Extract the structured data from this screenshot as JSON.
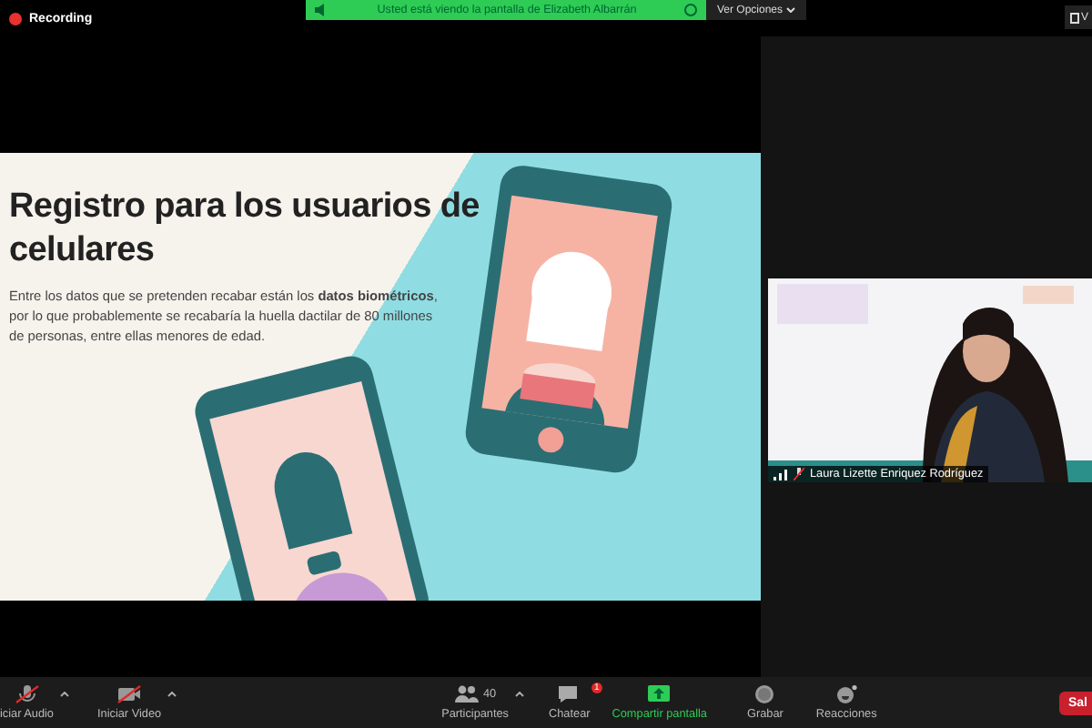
{
  "top_bar": {
    "recording": "Recording",
    "banner": "Usted está viendo la pantalla de Elizabeth Albarrán",
    "options": "Ver Opciones",
    "view_button": "V"
  },
  "slide": {
    "title": "Registro para los usuarios de celulares",
    "body": "Entre los datos que se pretenden recabar están los **datos biométricos**, por lo que probablemente se recabaría la huella dactilar de 80 millones de personas, entre ellas menores de edad."
  },
  "video_tile": {
    "kind": "picture",
    "name": "Laura Lizette Enriquez Rodríguez"
  },
  "toolbar": [
    {
      "kind": "audio",
      "label": "iciar Audio",
      "off": true
    },
    {
      "kind": "video",
      "label": "Iniciar Video",
      "off": true
    },
    {
      "kind": "participants",
      "label": "Participantes",
      "count": "40"
    },
    {
      "kind": "chat",
      "label": "Chatear",
      "badge": "1"
    },
    {
      "kind": "share",
      "label": "Compartir pantalla"
    },
    {
      "kind": "record",
      "label": "Grabar"
    },
    {
      "kind": "reactions",
      "label": "Reacciones"
    }
  ],
  "leave_button": "Sal"
}
